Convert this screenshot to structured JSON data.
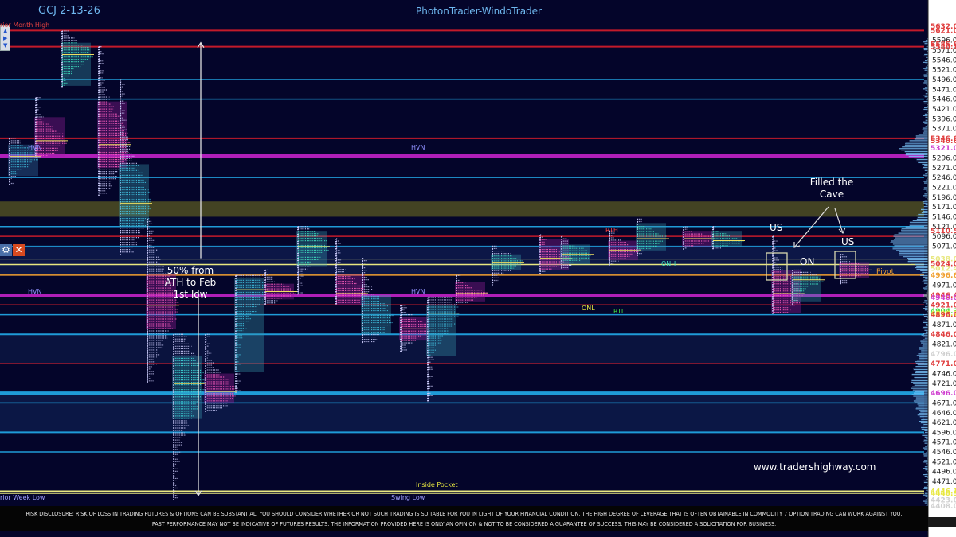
{
  "header": {
    "symbol": "GCJ 2-13-26",
    "title": "PhotonTrader-WindoTrader"
  },
  "colors": {
    "background": "#04052a",
    "grid_blue": "#1f9bd8",
    "red": "#c41a2a",
    "magenta": "#b01fb8",
    "yellow": "#e8e880",
    "olive_band": "#4a4a22"
  },
  "annotations": {
    "fifty_pct": [
      "50% from",
      "ATH to Feb",
      "1st low"
    ],
    "filled_cave": [
      "Filled the",
      "Cave"
    ],
    "us_left": "US",
    "us_right": "US",
    "on": "ON",
    "pivot": "Pivot",
    "hvn_1": "HVN",
    "hvn_2": "HVN",
    "hvn_3": "HVN",
    "hvn_4": "HVN",
    "rth": "RTH",
    "onh": "ONH",
    "onl": "ONL",
    "rtl": "RTL",
    "prior_month_high": "rior Month High",
    "prior_week_low": "rior Week Low",
    "swing_low": "Swing Low",
    "inside_pocket": "Inside Pocket"
  },
  "website": "www.tradershighway.com",
  "disclaimer": [
    "RISK DISCLOSURE: RISK OF LOSS IN TRADING FUTURES & OPTIONS CAN BE SUBSTANTIAL. YOU SHOULD CONSIDER WHETHER OR NOT SUCH TRADING IS SUITABLE FOR YOU IN LIGHT OF YOUR FINANCIAL CONDITION. THE HIGH DEGREE OF LEVERAGE THAT IS OFTEN OBTAINABLE IN COMMODITY 7 OPTION TRADING CAN WORK AGAINST YOU.",
    "PAST PERFORMANCE MAY NOT BE INDICATIVE OF FUTURES RESULTS. THE INFORMATION PROVIDED HERE IS ONLY AN OPINION & NOT TO BE CONSIDERED A GUARANTEE OF SUCCESS. THIS MAY BE CONSIDERED A SOLICITATION FOR BUSINESS."
  ],
  "chart_data": {
    "type": "market-profile",
    "ylim": [
      4408,
      5630
    ],
    "y_ticks": [
      5596,
      5571,
      5546,
      5521,
      5496,
      5471,
      5446,
      5421,
      5396,
      5371,
      5296,
      5271,
      5246,
      5221,
      5196,
      5171,
      5146,
      5121,
      5096,
      5071,
      4971,
      4871,
      4821,
      4746,
      4721,
      4671,
      4646,
      4621,
      4596,
      4571,
      4546,
      4521,
      4496,
      4471
    ],
    "highlighted_price_labels": [
      {
        "text": "5632.0",
        "value": 5632,
        "color": "#e04040"
      },
      {
        "text": "5621.0",
        "value": 5621,
        "color": "#e04040"
      },
      {
        "text": "5585.8",
        "value": 5586,
        "color": "#e04040"
      },
      {
        "text": "5580.1",
        "value": 5580,
        "color": "#e04040"
      },
      {
        "text": "5346.6",
        "value": 5346,
        "color": "#e04040"
      },
      {
        "text": "5340.6",
        "value": 5340,
        "color": "#e04040"
      },
      {
        "text": "5321.0",
        "value": 5321,
        "color": "#d040d0"
      },
      {
        "text": "5110.5",
        "value": 5110,
        "color": "#e04040"
      },
      {
        "text": "5038.0",
        "value": 5038,
        "color": "#e8e880"
      },
      {
        "text": "5024.0",
        "value": 5026,
        "color": "#e04040"
      },
      {
        "text": "5012.4",
        "value": 5014,
        "color": "#e8e880"
      },
      {
        "text": "4996.6",
        "value": 4997,
        "color": "#f0a030"
      },
      {
        "text": "4946.4",
        "value": 4946,
        "color": "#e04040"
      },
      {
        "text": "4940.0",
        "value": 4940,
        "color": "#d040d0"
      },
      {
        "text": "4921.0",
        "value": 4921,
        "color": "#e04040"
      },
      {
        "text": "4904.3",
        "value": 4905,
        "color": "#40e040"
      },
      {
        "text": "4898.7",
        "value": 4899,
        "color": "#e8e840"
      },
      {
        "text": "4896.0",
        "value": 4896,
        "color": "#e04040"
      },
      {
        "text": "4846.0",
        "value": 4846,
        "color": "#e04040"
      },
      {
        "text": "4796.0",
        "value": 4796,
        "color": "#d0d0d0"
      },
      {
        "text": "4771.0",
        "value": 4771,
        "color": "#e04040"
      },
      {
        "text": "4696.0",
        "value": 4696,
        "color": "#d040d0"
      },
      {
        "text": "4446.1",
        "value": 4446,
        "color": "#e8e840"
      },
      {
        "text": "4440.5",
        "value": 4440,
        "color": "#e8e840"
      },
      {
        "text": "4423.0",
        "value": 4423,
        "color": "#d0d0d0"
      },
      {
        "text": "4408.0",
        "value": 4408,
        "color": "#d0d0d0"
      }
    ],
    "levels": [
      {
        "price": 5621,
        "color": "#c41a2a",
        "width": 2,
        "span": "full"
      },
      {
        "price": 5580,
        "color": "#c41a2a",
        "width": 2,
        "span": "full"
      },
      {
        "price": 5496,
        "color": "#1f9bd8",
        "width": 1.5,
        "span": "full"
      },
      {
        "price": 5446,
        "color": "#1f9bd8",
        "width": 1.5,
        "span": "full"
      },
      {
        "price": 5346,
        "color": "#c41a2a",
        "width": 2,
        "span": "full"
      },
      {
        "price": 5301,
        "color": "#b01fb8",
        "width": 5,
        "span": "full"
      },
      {
        "price": 5246,
        "color": "#1f9bd8",
        "width": 1.5,
        "span": "full"
      },
      {
        "price": 5121,
        "color": "#1f9bd8",
        "width": 1.5,
        "span": "full"
      },
      {
        "price": 5096,
        "color": "#c41a2a",
        "width": 1.5,
        "span": "full"
      },
      {
        "price": 5071,
        "color": "#1f9bd8",
        "width": 1,
        "span": "full"
      },
      {
        "price": 5038,
        "color": "#e8e880",
        "width": 1,
        "span": "full"
      },
      {
        "price": 5024,
        "color": "#e8e880",
        "width": 1.5,
        "span": "full"
      },
      {
        "price": 4997,
        "color": "#f0a030",
        "width": 1.5,
        "span": "full"
      },
      {
        "price": 4946,
        "color": "#b01fb8",
        "width": 4,
        "span": "full"
      },
      {
        "price": 4921,
        "color": "#c41a2a",
        "width": 1.5,
        "span": "full"
      },
      {
        "price": 4896,
        "color": "#1f9bd8",
        "width": 1.5,
        "span": "full"
      },
      {
        "price": 4846,
        "color": "#1f9bd8",
        "width": 2,
        "span": "full"
      },
      {
        "price": 4771,
        "color": "#c41a2a",
        "width": 1.5,
        "span": "full"
      },
      {
        "price": 4696,
        "color": "#1f9bd8",
        "width": 4,
        "span": "full"
      },
      {
        "price": 4671,
        "color": "#1f9bd8",
        "width": 1.5,
        "span": "full"
      },
      {
        "price": 4596,
        "color": "#1f9bd8",
        "width": 2,
        "span": "full"
      },
      {
        "price": 4546,
        "color": "#1f9bd8",
        "width": 1.5,
        "span": "full"
      },
      {
        "price": 4446,
        "color": "#e8e880",
        "width": 1.5,
        "span": "full"
      },
      {
        "price": 4440,
        "color": "#e8e880",
        "width": 1,
        "span": "full"
      }
    ],
    "bands": [
      {
        "high": 5185,
        "low": 5146,
        "color": "#4a4a22"
      },
      {
        "high": 5071,
        "low": 4996,
        "color": "#0d1a4a"
      },
      {
        "high": 4846,
        "low": 4771,
        "color": "#0b1540"
      },
      {
        "high": 4696,
        "low": 4596,
        "color": "#0c1a48"
      }
    ],
    "sessions": [
      {
        "x": 12,
        "high": 5346,
        "low": 5225,
        "poc": 5300,
        "value_high": 5330,
        "value_low": 5250,
        "colors": [
          "#40c0e0",
          "#d0d0ff"
        ],
        "box": "#3a7ab0"
      },
      {
        "x": 45,
        "high": 5450,
        "low": 5296,
        "poc": 5340,
        "value_high": 5400,
        "value_low": 5300,
        "colors": [
          "#ff60c0",
          "#d0d0ff"
        ],
        "box": "#a020a0"
      },
      {
        "x": 78,
        "high": 5620,
        "low": 5475,
        "poc": 5560,
        "value_high": 5590,
        "value_low": 5480,
        "colors": [
          "#40e0c0",
          "#d0d0ff"
        ],
        "box": "#3a9ab0"
      },
      {
        "x": 124,
        "high": 5580,
        "low": 5200,
        "poc": 5330,
        "value_high": 5440,
        "value_low": 5270,
        "colors": [
          "#ff60c0",
          "#d0d0ff"
        ],
        "box": "#a020a0"
      },
      {
        "x": 151,
        "high": 5496,
        "low": 5050,
        "poc": 5180,
        "value_high": 5280,
        "value_low": 5120,
        "colors": [
          "#40c0e0",
          "#d0d0ff"
        ],
        "box": "#3a9ab0"
      },
      {
        "x": 185,
        "high": 5140,
        "low": 4721,
        "poc": 4920,
        "value_high": 5000,
        "value_low": 4860,
        "colors": [
          "#ff60c0",
          "#d0d0ff"
        ],
        "box": "#a020a0"
      },
      {
        "x": 218,
        "high": 4846,
        "low": 4423,
        "poc": 4720,
        "value_high": 4790,
        "value_low": 4630,
        "colors": [
          "#40e0e0",
          "#d0d0ff"
        ],
        "box": "#3a9ab0"
      },
      {
        "x": 258,
        "high": 4846,
        "low": 4646,
        "poc": 4700,
        "value_high": 4746,
        "value_low": 4671,
        "colors": [
          "#ff60c0",
          "#d0d0ff"
        ],
        "box": "#a020a0"
      },
      {
        "x": 296,
        "high": 4996,
        "low": 4696,
        "poc": 4960,
        "value_high": 4990,
        "value_low": 4750,
        "colors": [
          "#40c0e0",
          "#d0d0ff"
        ],
        "box": "#3a9ab0"
      },
      {
        "x": 333,
        "high": 5010,
        "low": 4920,
        "poc": 4955,
        "value_high": 4975,
        "value_low": 4935,
        "colors": [
          "#ff60c0",
          "#d0d0ff"
        ],
        "box": "#a020a0"
      },
      {
        "x": 374,
        "high": 5121,
        "low": 4946,
        "poc": 5070,
        "value_high": 5110,
        "value_low": 5020,
        "colors": [
          "#40e0c0",
          "#d0d0ff"
        ],
        "box": "#3a9ab0"
      },
      {
        "x": 422,
        "high": 5090,
        "low": 4921,
        "poc": 4950,
        "value_high": 5000,
        "value_low": 4921,
        "colors": [
          "#ff60c0",
          "#d0d0ff"
        ],
        "box": "#a020a0"
      },
      {
        "x": 455,
        "high": 5040,
        "low": 4821,
        "poc": 4890,
        "value_high": 4946,
        "value_low": 4846,
        "colors": [
          "#40c0e0",
          "#d0d0ff"
        ],
        "box": "#3a9ab0"
      },
      {
        "x": 503,
        "high": 4920,
        "low": 4800,
        "poc": 4860,
        "value_high": 4890,
        "value_low": 4830,
        "colors": [
          "#ff60c0",
          "#d0d0ff"
        ],
        "box": "#a020a0"
      },
      {
        "x": 537,
        "high": 4940,
        "low": 4671,
        "poc": 4900,
        "value_high": 4921,
        "value_low": 4790,
        "colors": [
          "#40c0e0",
          "#d0d0ff"
        ],
        "box": "#3a9ab0"
      },
      {
        "x": 573,
        "high": 4996,
        "low": 4921,
        "poc": 4950,
        "value_high": 4980,
        "value_low": 4930,
        "colors": [
          "#ff60c0",
          "#d0d0ff"
        ],
        "box": "#a020a0"
      },
      {
        "x": 618,
        "high": 5071,
        "low": 4971,
        "poc": 5030,
        "value_high": 5050,
        "value_low": 5010,
        "colors": [
          "#40e0c0",
          "#d0d0ff"
        ],
        "box": "#3a9ab0"
      },
      {
        "x": 678,
        "high": 5100,
        "low": 5000,
        "poc": 5040,
        "value_high": 5090,
        "value_low": 5010,
        "colors": [
          "#ff60c0",
          "#d0d0ff"
        ],
        "box": "#a020a0"
      },
      {
        "x": 705,
        "high": 5096,
        "low": 5010,
        "poc": 5050,
        "value_high": 5075,
        "value_low": 5025,
        "colors": [
          "#40e0c0",
          "#d0d0ff"
        ],
        "box": "#3a9ab0"
      },
      {
        "x": 765,
        "high": 5110,
        "low": 5021,
        "poc": 5060,
        "value_high": 5085,
        "value_low": 5035,
        "colors": [
          "#ff60c0",
          "#d0d0ff"
        ],
        "box": "#a020a0"
      },
      {
        "x": 800,
        "high": 5140,
        "low": 5046,
        "poc": 5090,
        "value_high": 5130,
        "value_low": 5060,
        "colors": [
          "#40e0c0",
          "#d0d0ff"
        ],
        "box": "#3a9ab0"
      },
      {
        "x": 858,
        "high": 5120,
        "low": 5060,
        "poc": 5090,
        "value_high": 5110,
        "value_low": 5070,
        "colors": [
          "#ff60c0",
          "#d0d0ff"
        ],
        "box": "#a020a0"
      },
      {
        "x": 895,
        "high": 5121,
        "low": 5060,
        "poc": 5085,
        "value_high": 5110,
        "value_low": 5070,
        "colors": [
          "#40e0c0",
          "#d0d0ff"
        ],
        "box": "#3a9ab0"
      },
      {
        "x": 970,
        "high": 5096,
        "low": 4896,
        "poc": 4950,
        "value_high": 5010,
        "value_low": 4900,
        "colors": [
          "#ff60c0",
          "#d0d0ff"
        ],
        "box": "#a020a0"
      },
      {
        "x": 995,
        "high": 5010,
        "low": 4921,
        "poc": 4985,
        "value_high": 4996,
        "value_low": 4930,
        "colors": [
          "#40e0c0",
          "#d0d0ff"
        ],
        "box": "#3a9ab0"
      },
      {
        "x": 1055,
        "high": 5050,
        "low": 4971,
        "poc": 5010,
        "value_high": 5030,
        "value_low": 4990,
        "colors": [
          "#ff60c0",
          "#d0d0ff"
        ],
        "box": "#a020a0"
      }
    ]
  }
}
